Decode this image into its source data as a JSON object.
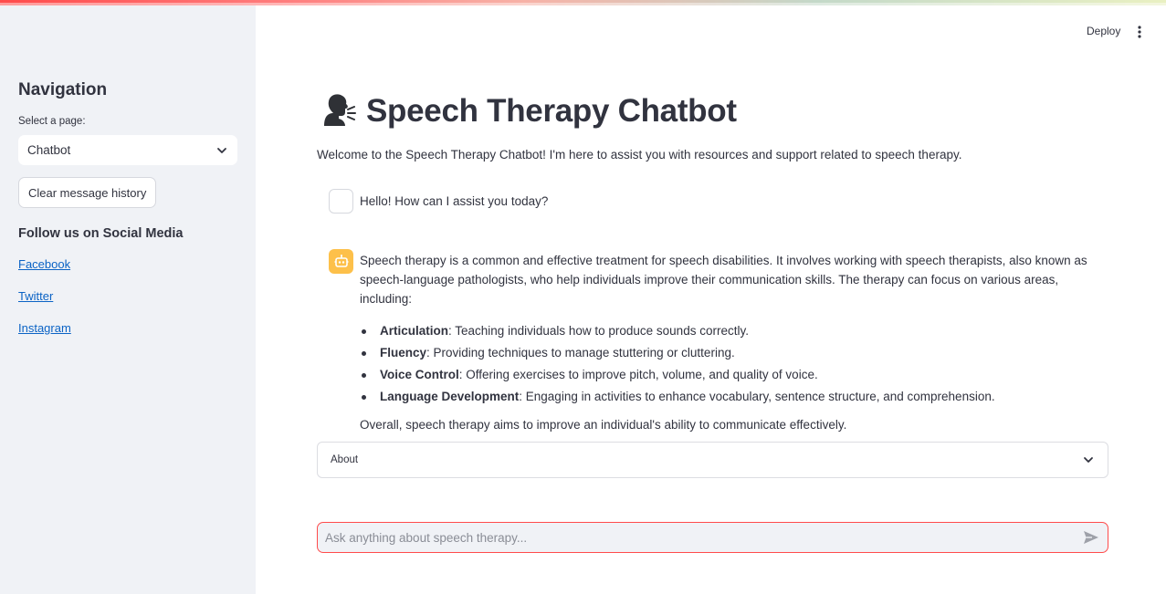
{
  "header": {
    "deploy_label": "Deploy"
  },
  "sidebar": {
    "title": "Navigation",
    "select_label": "Select a page:",
    "select_value": "Chatbot",
    "clear_button": "Clear message history",
    "social_title": "Follow us on Social Media",
    "links": [
      "Facebook",
      "Twitter",
      "Instagram"
    ]
  },
  "main": {
    "title": "Speech Therapy Chatbot",
    "welcome": "Welcome to the Speech Therapy Chatbot! I'm here to assist you with resources and support related to speech therapy.",
    "messages": {
      "user_text": "Hello! How can I assist you today?",
      "bot_intro": "Speech therapy is a common and effective treatment for speech disabilities. It involves working with speech therapists, also known as speech-language pathologists, who help individuals improve their communication skills. The therapy can focus on various areas, including:",
      "bullets": [
        {
          "term": "Articulation",
          "desc": ": Teaching individuals how to produce sounds correctly."
        },
        {
          "term": "Fluency",
          "desc": ": Providing techniques to manage stuttering or cluttering."
        },
        {
          "term": "Voice Control",
          "desc": ": Offering exercises to improve pitch, volume, and quality of voice."
        },
        {
          "term": "Language Development",
          "desc": ": Engaging in activities to enhance vocabulary, sentence structure, and comprehension."
        }
      ],
      "bot_closing": "Overall, speech therapy aims to improve an individual's ability to communicate effectively."
    },
    "expander_label": "About",
    "chat_placeholder": "Ask anything about speech therapy..."
  },
  "colors": {
    "accent": "#ff4b4b",
    "sidebar_bg": "#f0f2f6",
    "bot_avatar": "#fdc04a",
    "link": "#0b63c5"
  }
}
